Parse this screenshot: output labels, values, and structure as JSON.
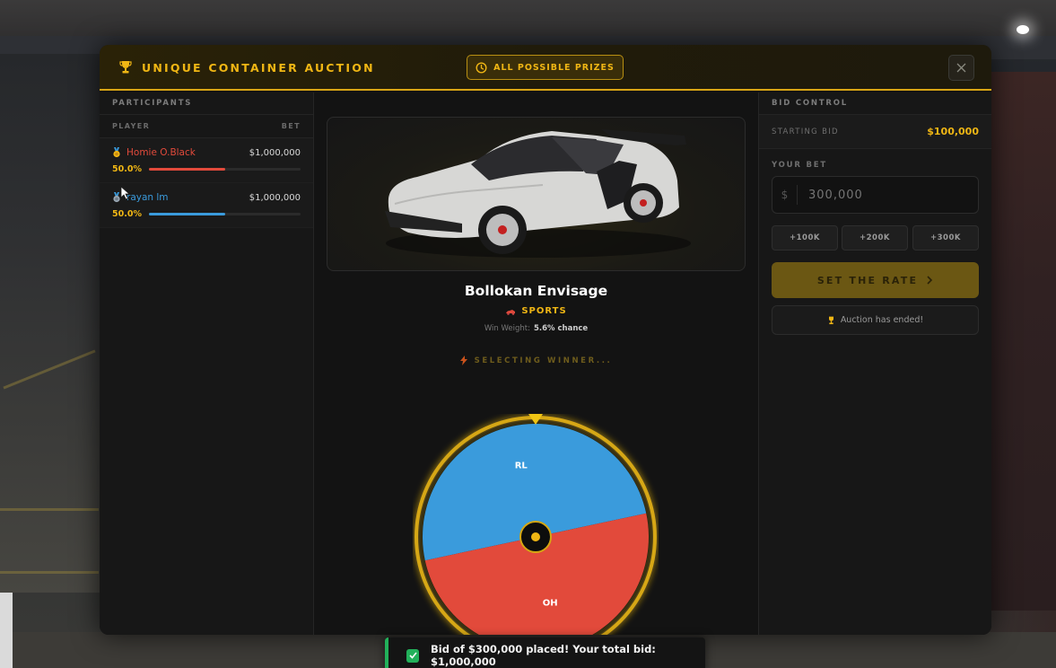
{
  "header": {
    "title": "UNIQUE CONTAINER AUCTION",
    "prizes_button": "ALL POSSIBLE PRIZES"
  },
  "participants": {
    "heading": "PARTICIPANTS",
    "col_player": "PLAYER",
    "col_bet": "BET",
    "rows": [
      {
        "name": "Homie O.Black",
        "bet": "$1,000,000",
        "pct_label": "50.0%",
        "share": 0.5,
        "color": "#e24a3b"
      },
      {
        "name": "rayan lm",
        "bet": "$1,000,000",
        "pct_label": "50.0%",
        "share": 0.5,
        "color": "#3a9bdc"
      }
    ]
  },
  "prize": {
    "name": "Bollokan Envisage",
    "class": "SPORTS",
    "win_weight_label": "Win Weight:",
    "win_weight_value": "5.6% chance"
  },
  "wheel": {
    "status": "SELECTING WINNER...",
    "segments": [
      {
        "label": "RL",
        "share": 0.5,
        "color": "#3a9bdc"
      },
      {
        "label": "OH",
        "share": 0.5,
        "color": "#e24a3b"
      }
    ]
  },
  "bid_control": {
    "heading": "BID CONTROL",
    "starting_bid_label": "STARTING BID",
    "starting_bid_value": "$100,000",
    "your_bet_label": "YOUR BET",
    "currency": "$",
    "bet_placeholder": "300,000",
    "quick_buttons": [
      "+100K",
      "+200K",
      "+300K"
    ],
    "set_rate": "SET THE RATE",
    "status": "Auction has ended!"
  },
  "toast": {
    "message": "Bid of $300,000 placed! Your total bid: $1,000,000"
  },
  "colors": {
    "accent": "#f0b614",
    "red": "#e24a3b",
    "blue": "#3a9bdc",
    "success": "#22b05a"
  }
}
